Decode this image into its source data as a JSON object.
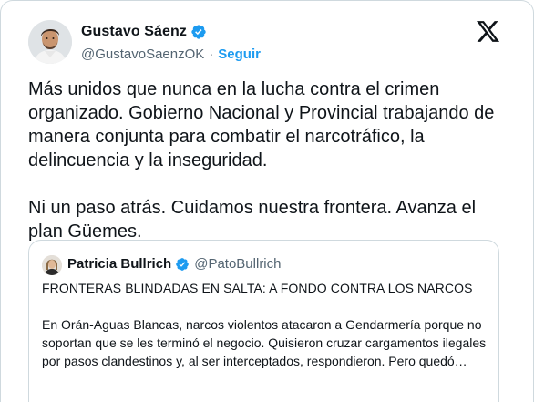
{
  "author": {
    "name": "Gustavo Sáenz",
    "handle": "@GustavoSaenzOK",
    "separator": "·",
    "follow_label": "Seguir",
    "verified_icon": "verified-badge-icon"
  },
  "platform_icon": "x-logo-icon",
  "tweet": {
    "text": "Más unidos que nunca en la lucha contra el crimen organizado. Gobierno Nacional y Provincial trabajando de manera conjunta para combatir el narcotráfico, la delincuencia y la inseguridad.\n\nNi un paso atrás. Cuidamos nuestra frontera. Avanza el plan Güemes."
  },
  "quote": {
    "name": "Patricia Bullrich",
    "handle": "@PatoBullrich",
    "headline": "FRONTERAS BLINDADAS EN SALTA: A FONDO CONTRA LOS NARCOS",
    "body": "En Orán-Aguas Blancas, narcos violentos atacaron a Gendarmería porque no soportan que se les terminó el negocio. Quisieron cruzar cargamentos ilegales por pasos clandestinos y, al ser interceptados, respondieron. Pero quedó…"
  },
  "colors": {
    "accent": "#1d9bf0",
    "text": "#0f1419",
    "muted": "#536471",
    "border": "#cfd9de"
  }
}
